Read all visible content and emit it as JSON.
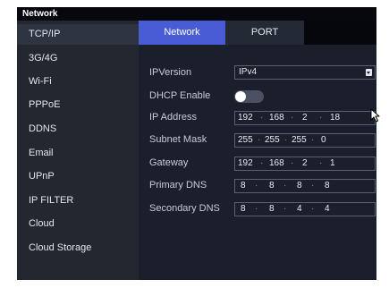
{
  "window": {
    "title": "Network"
  },
  "sidebar": {
    "items": [
      {
        "label": "TCP/IP"
      },
      {
        "label": "3G/4G"
      },
      {
        "label": "Wi-Fi"
      },
      {
        "label": "PPPoE"
      },
      {
        "label": "DDNS"
      },
      {
        "label": "Email"
      },
      {
        "label": "UPnP"
      },
      {
        "label": "IP FILTER"
      },
      {
        "label": "Cloud"
      },
      {
        "label": "Cloud Storage"
      }
    ]
  },
  "tabs": [
    {
      "label": "Network",
      "active": true
    },
    {
      "label": "PORT",
      "active": false
    }
  ],
  "form": {
    "ip_version": {
      "label": "IPVersion",
      "value": "IPv4"
    },
    "dhcp": {
      "label": "DHCP Enable",
      "enabled": false
    },
    "ip_address": {
      "label": "IP Address",
      "octets": [
        "192",
        "168",
        "2",
        "18"
      ]
    },
    "subnet_mask": {
      "label": "Subnet Mask",
      "octets": [
        "255",
        "255",
        "255",
        "0"
      ]
    },
    "gateway": {
      "label": "Gateway",
      "octets": [
        "192",
        "168",
        "2",
        "1"
      ]
    },
    "primary_dns": {
      "label": "Primary DNS",
      "octets": [
        "8",
        "8",
        "8",
        "8"
      ]
    },
    "secondary_dns": {
      "label": "Secondary DNS",
      "octets": [
        "8",
        "8",
        "4",
        "4"
      ]
    },
    "octet_separator": "·"
  },
  "colors": {
    "tab_active": "#4a5bd6",
    "sidebar_bg": "#222730",
    "content_bg": "#1b1f2b",
    "titlebar_bg": "#06080d"
  },
  "icons": {
    "select": "chevron-down-icon",
    "cursor": "mouse-pointer-icon"
  }
}
